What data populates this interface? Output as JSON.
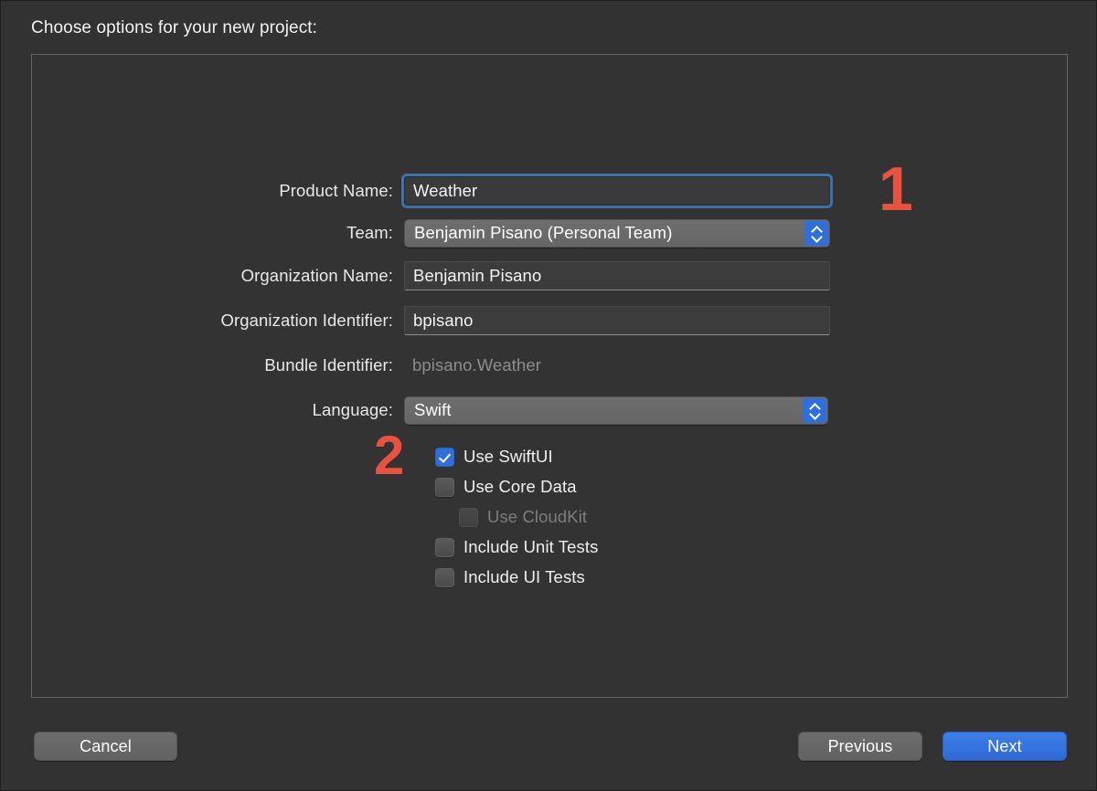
{
  "window": {
    "prompt": "Choose options for your new project:",
    "background_color": "#323232",
    "panel_color": "#333333",
    "accent_color": "#2f6fdc",
    "annotation_color": "#e8523f"
  },
  "form": {
    "fields": [
      {
        "label": "Product Name:",
        "type": "textfield",
        "value": "Weather",
        "focused": true,
        "name": "product-name"
      },
      {
        "label": "Team:",
        "type": "popup",
        "value": "Benjamin Pisano (Personal Team)",
        "name": "team"
      },
      {
        "label": "Organization Name:",
        "type": "textfield",
        "value": "Benjamin Pisano",
        "focused": false,
        "name": "organization-name"
      },
      {
        "label": "Organization Identifier:",
        "type": "textfield",
        "value": "bpisano",
        "focused": false,
        "name": "organization-identifier"
      },
      {
        "label": "Bundle Identifier:",
        "type": "static",
        "value": "bpisano.Weather",
        "name": "bundle-identifier"
      },
      {
        "label": "Language:",
        "type": "popup",
        "value": "Swift",
        "name": "language"
      }
    ],
    "checkboxes": [
      {
        "label": "Use SwiftUI",
        "checked": true,
        "disabled": false,
        "indented": false,
        "name": "use-swiftui"
      },
      {
        "label": "Use Core Data",
        "checked": false,
        "disabled": false,
        "indented": false,
        "name": "use-core-data"
      },
      {
        "label": "Use CloudKit",
        "checked": false,
        "disabled": true,
        "indented": true,
        "name": "use-cloudkit"
      },
      {
        "label": "Include Unit Tests",
        "checked": false,
        "disabled": false,
        "indented": false,
        "name": "include-unit-tests"
      },
      {
        "label": "Include UI Tests",
        "checked": false,
        "disabled": false,
        "indented": false,
        "name": "include-ui-tests"
      }
    ]
  },
  "annotations": [
    {
      "text": "1",
      "name": "annotation-1"
    },
    {
      "text": "2",
      "name": "annotation-2"
    }
  ],
  "footer": {
    "cancel_label": "Cancel",
    "previous_label": "Previous",
    "next_label": "Next"
  }
}
